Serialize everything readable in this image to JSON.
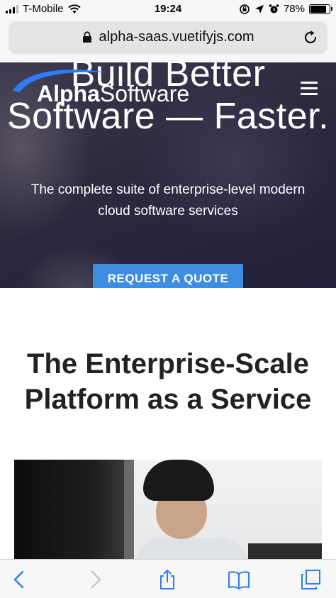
{
  "status_bar": {
    "carrier": "T-Mobile",
    "time": "19:24",
    "battery_percent": "78%",
    "battery_level": 0.78,
    "icons": [
      "signal-icon",
      "wifi-icon",
      "lock-rotation-icon",
      "location-icon",
      "alarm-icon",
      "battery-icon"
    ]
  },
  "browser": {
    "url": "alpha-saas.vuetifyjs.com",
    "icons": [
      "lock-icon",
      "reload-icon"
    ]
  },
  "hero": {
    "logo_bold": "Alpha",
    "logo_light": "Software",
    "title": "Build Better Software — Faster.",
    "subtitle": "The complete suite of enterprise-level modern cloud software services",
    "cta_label": "REQUEST A QUOTE",
    "menu_icon": "menu-icon"
  },
  "main": {
    "section_title": "The Enterprise-Scale Platform as a Service"
  },
  "toolbar": {
    "icons": [
      "back-icon",
      "forward-icon",
      "share-icon",
      "bookmarks-icon",
      "tabs-icon"
    ]
  },
  "colors": {
    "accent": "#3d8ee0",
    "ios_blue": "#2f7cf6",
    "hero_bg": "#2c2a3e"
  }
}
